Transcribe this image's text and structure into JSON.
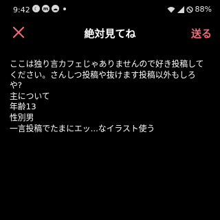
{
  "status_bar": {
    "time": "9:42",
    "icons": [
      "moon-circle-icon",
      "messenger-circle-icon",
      "cloud-circle-icon",
      "dot-icon"
    ],
    "right_icons": [
      "wifi-icon",
      "signal-icon",
      "do-not-disturb-icon"
    ],
    "battery": "88%"
  },
  "header": {
    "title": "絶対見てね",
    "send_label": "送る",
    "close_icon": "close-icon",
    "accent_color": "#ee6b78"
  },
  "post": {
    "lines": [
      "ここは独り言カフェじゃありませんので好き投稿して",
      "ください。さんしつ投稿や抜けます投稿以外もしろ",
      "や?",
      "主について",
      "年齢13",
      "性別男",
      "一言投稿でたまにエッ...なイラスト使う"
    ]
  }
}
